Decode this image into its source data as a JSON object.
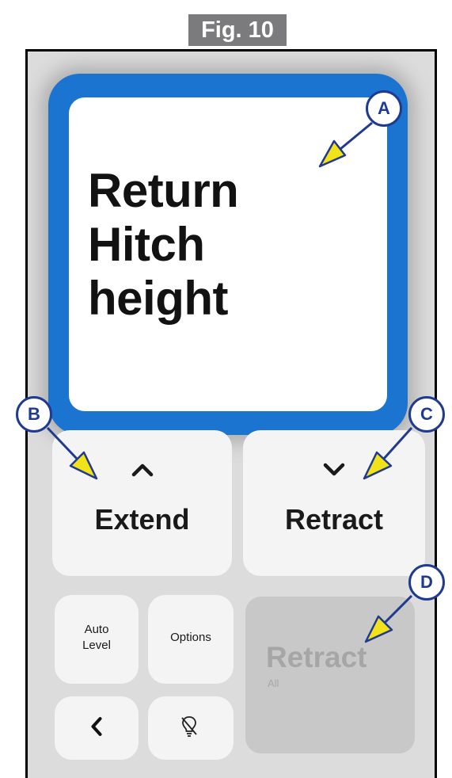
{
  "figure_label": "Fig. 10",
  "display": {
    "lines": [
      "Return",
      "Hitch",
      "height"
    ],
    "border_color": "#1b74cf"
  },
  "buttons": {
    "extend": {
      "label": "Extend",
      "icon": "chevron-up-icon"
    },
    "retract": {
      "label": "Retract",
      "icon": "chevron-down-icon"
    },
    "auto_level": {
      "line1": "Auto",
      "line2": "Level"
    },
    "options": {
      "label": "Options"
    },
    "back": {
      "icon": "chevron-left-icon"
    },
    "light": {
      "icon": "light-off-icon"
    },
    "retract_all": {
      "label": "Retract",
      "sublabel": "All",
      "state": "disabled"
    }
  },
  "callouts": [
    "A",
    "B",
    "C",
    "D"
  ],
  "colors": {
    "callout": "#1f3a8f",
    "arrow_fill": "#f2e21a"
  }
}
